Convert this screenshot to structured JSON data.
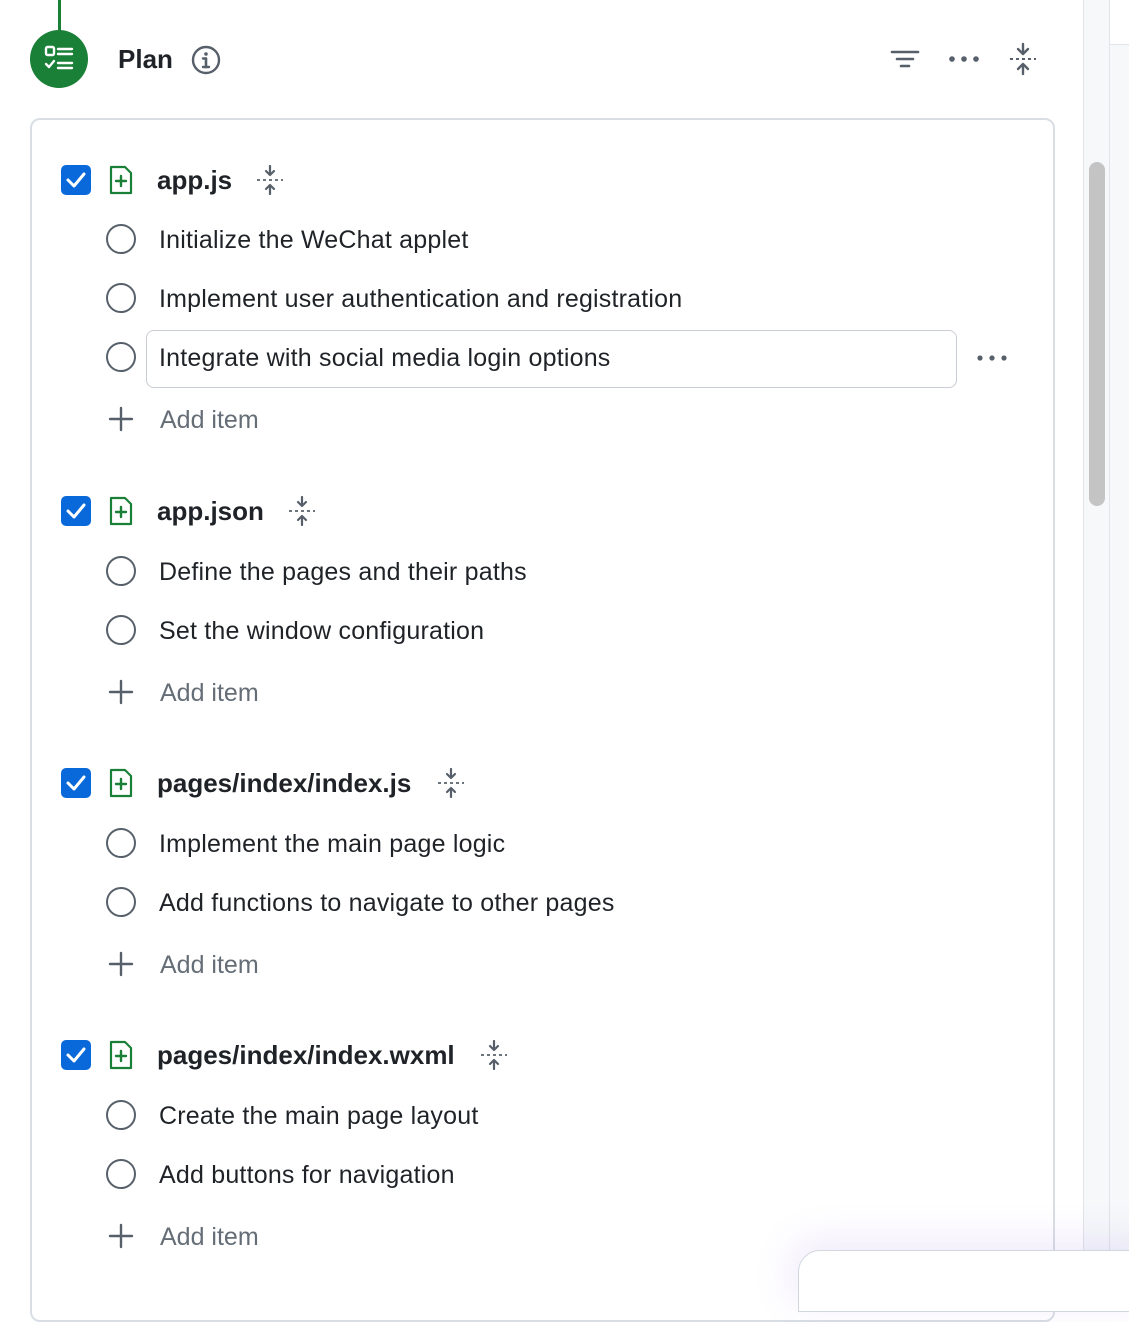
{
  "header": {
    "title": "Plan",
    "icons": {
      "badge": "checklist-icon",
      "info": "info-icon",
      "filter": "filter-icon",
      "more": "kebab-horizontal-icon",
      "collapse": "fold-icon"
    }
  },
  "colors": {
    "accent_green": "#1a7f37",
    "checkbox_blue": "#0969da"
  },
  "files": [
    {
      "name": "app.js",
      "checked": true,
      "items": [
        "Initialize the WeChat applet",
        "Implement user authentication and registration",
        "Integrate with social media login options"
      ],
      "add_label": "Add item"
    },
    {
      "name": "app.json",
      "checked": true,
      "items": [
        "Define the pages and their paths",
        "Set the window configuration"
      ],
      "add_label": "Add item"
    },
    {
      "name": "pages/index/index.js",
      "checked": true,
      "items": [
        "Implement the main page logic",
        "Add functions to navigate to other pages"
      ],
      "add_label": "Add item"
    },
    {
      "name": "pages/index/index.wxml",
      "checked": true,
      "items": [
        "Create the main page layout",
        "Add buttons for navigation"
      ],
      "add_label": "Add item"
    }
  ]
}
